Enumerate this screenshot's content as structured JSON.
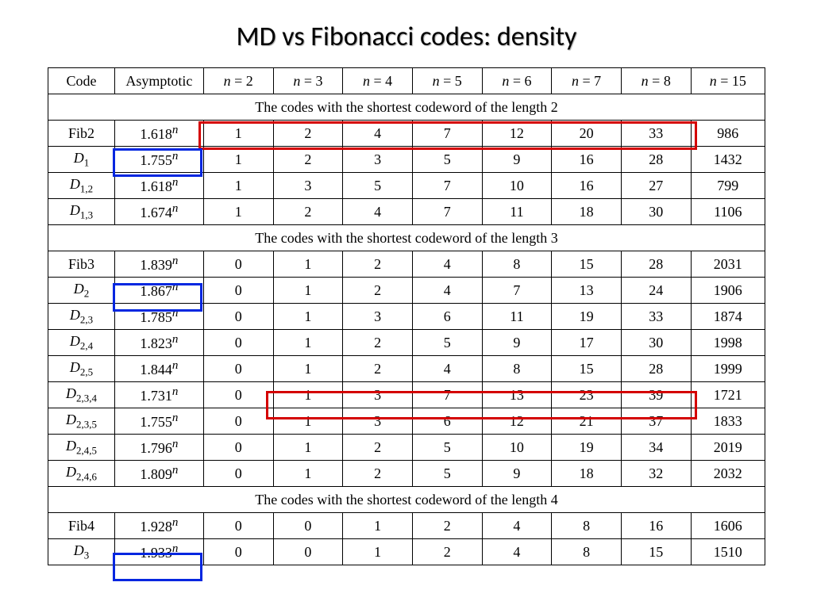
{
  "title": "MD vs Fibonacci codes: density",
  "headers": {
    "code": "Code",
    "asym": "Asymptotic",
    "n2": "n = 2",
    "n3": "n = 3",
    "n4": "n = 4",
    "n5": "n = 5",
    "n6": "n = 6",
    "n7": "n = 7",
    "n8": "n = 8",
    "n15": "n = 15"
  },
  "sections": {
    "s2": "The codes with the shortest codeword of the length 2",
    "s3": "The codes with the shortest codeword of the length 3",
    "s4": "The codes with the shortest codeword of the length 4"
  },
  "chart_data": {
    "type": "table",
    "title": "MD vs Fibonacci codes: density",
    "columns": [
      "Code",
      "Asymptotic",
      "n=2",
      "n=3",
      "n=4",
      "n=5",
      "n=6",
      "n=7",
      "n=8",
      "n=15"
    ],
    "groups": [
      {
        "label": "The codes with the shortest codeword of the length 2",
        "rows": [
          {
            "code": "Fib2",
            "asym": "1.618^n",
            "v": [
              1,
              2,
              4,
              7,
              12,
              20,
              33,
              986
            ]
          },
          {
            "code": "D1",
            "asym": "1.755^n",
            "v": [
              1,
              2,
              3,
              5,
              9,
              16,
              28,
              1432
            ]
          },
          {
            "code": "D1,2",
            "asym": "1.618^n",
            "v": [
              1,
              3,
              5,
              7,
              10,
              16,
              27,
              799
            ]
          },
          {
            "code": "D1,3",
            "asym": "1.674^n",
            "v": [
              1,
              2,
              4,
              7,
              11,
              18,
              30,
              1106
            ]
          }
        ]
      },
      {
        "label": "The codes with the shortest codeword of the length 3",
        "rows": [
          {
            "code": "Fib3",
            "asym": "1.839^n",
            "v": [
              0,
              1,
              2,
              4,
              8,
              15,
              28,
              2031
            ]
          },
          {
            "code": "D2",
            "asym": "1.867^n",
            "v": [
              0,
              1,
              2,
              4,
              7,
              13,
              24,
              1906
            ]
          },
          {
            "code": "D2,3",
            "asym": "1.785^n",
            "v": [
              0,
              1,
              3,
              6,
              11,
              19,
              33,
              1874
            ]
          },
          {
            "code": "D2,4",
            "asym": "1.823^n",
            "v": [
              0,
              1,
              2,
              5,
              9,
              17,
              30,
              1998
            ]
          },
          {
            "code": "D2,5",
            "asym": "1.844^n",
            "v": [
              0,
              1,
              2,
              4,
              8,
              15,
              28,
              1999
            ]
          },
          {
            "code": "D2,3,4",
            "asym": "1.731^n",
            "v": [
              0,
              1,
              3,
              7,
              13,
              23,
              39,
              1721
            ]
          },
          {
            "code": "D2,3,5",
            "asym": "1.755^n",
            "v": [
              0,
              1,
              3,
              6,
              12,
              21,
              37,
              1833
            ]
          },
          {
            "code": "D2,4,5",
            "asym": "1.796^n",
            "v": [
              0,
              1,
              2,
              5,
              10,
              19,
              34,
              2019
            ]
          },
          {
            "code": "D2,4,6",
            "asym": "1.809^n",
            "v": [
              0,
              1,
              2,
              5,
              9,
              18,
              32,
              2032
            ]
          }
        ]
      },
      {
        "label": "The codes with the shortest codeword of the length 4",
        "rows": [
          {
            "code": "Fib4",
            "asym": "1.928^n",
            "v": [
              0,
              0,
              1,
              2,
              4,
              8,
              16,
              1606
            ]
          },
          {
            "code": "D3",
            "asym": "1.933^n",
            "v": [
              0,
              0,
              1,
              2,
              4,
              8,
              15,
              1510
            ]
          }
        ]
      }
    ]
  },
  "rows": {
    "fib2": {
      "a": "1.618",
      "v": [
        "1",
        "2",
        "4",
        "7",
        "12",
        "20",
        "33",
        "986"
      ]
    },
    "d1": {
      "a": "1.755",
      "v": [
        "1",
        "2",
        "3",
        "5",
        "9",
        "16",
        "28",
        "1432"
      ]
    },
    "d12": {
      "a": "1.618",
      "v": [
        "1",
        "3",
        "5",
        "7",
        "10",
        "16",
        "27",
        "799"
      ]
    },
    "d13": {
      "a": "1.674",
      "v": [
        "1",
        "2",
        "4",
        "7",
        "11",
        "18",
        "30",
        "1106"
      ]
    },
    "fib3": {
      "a": "1.839",
      "v": [
        "0",
        "1",
        "2",
        "4",
        "8",
        "15",
        "28",
        "2031"
      ]
    },
    "d2": {
      "a": "1.867",
      "v": [
        "0",
        "1",
        "2",
        "4",
        "7",
        "13",
        "24",
        "1906"
      ]
    },
    "d23": {
      "a": "1.785",
      "v": [
        "0",
        "1",
        "3",
        "6",
        "11",
        "19",
        "33",
        "1874"
      ]
    },
    "d24": {
      "a": "1.823",
      "v": [
        "0",
        "1",
        "2",
        "5",
        "9",
        "17",
        "30",
        "1998"
      ]
    },
    "d25": {
      "a": "1.844",
      "v": [
        "0",
        "1",
        "2",
        "4",
        "8",
        "15",
        "28",
        "1999"
      ]
    },
    "d234": {
      "a": "1.731",
      "v": [
        "0",
        "1",
        "3",
        "7",
        "13",
        "23",
        "39",
        "1721"
      ]
    },
    "d235": {
      "a": "1.755",
      "v": [
        "0",
        "1",
        "3",
        "6",
        "12",
        "21",
        "37",
        "1833"
      ]
    },
    "d245": {
      "a": "1.796",
      "v": [
        "0",
        "1",
        "2",
        "5",
        "10",
        "19",
        "34",
        "2019"
      ]
    },
    "d246": {
      "a": "1.809",
      "v": [
        "0",
        "1",
        "2",
        "5",
        "9",
        "18",
        "32",
        "2032"
      ]
    },
    "fib4": {
      "a": "1.928",
      "v": [
        "0",
        "0",
        "1",
        "2",
        "4",
        "8",
        "16",
        "1606"
      ]
    },
    "d3": {
      "a": "1.933",
      "v": [
        "0",
        "0",
        "1",
        "2",
        "4",
        "8",
        "15",
        "1510"
      ]
    }
  }
}
